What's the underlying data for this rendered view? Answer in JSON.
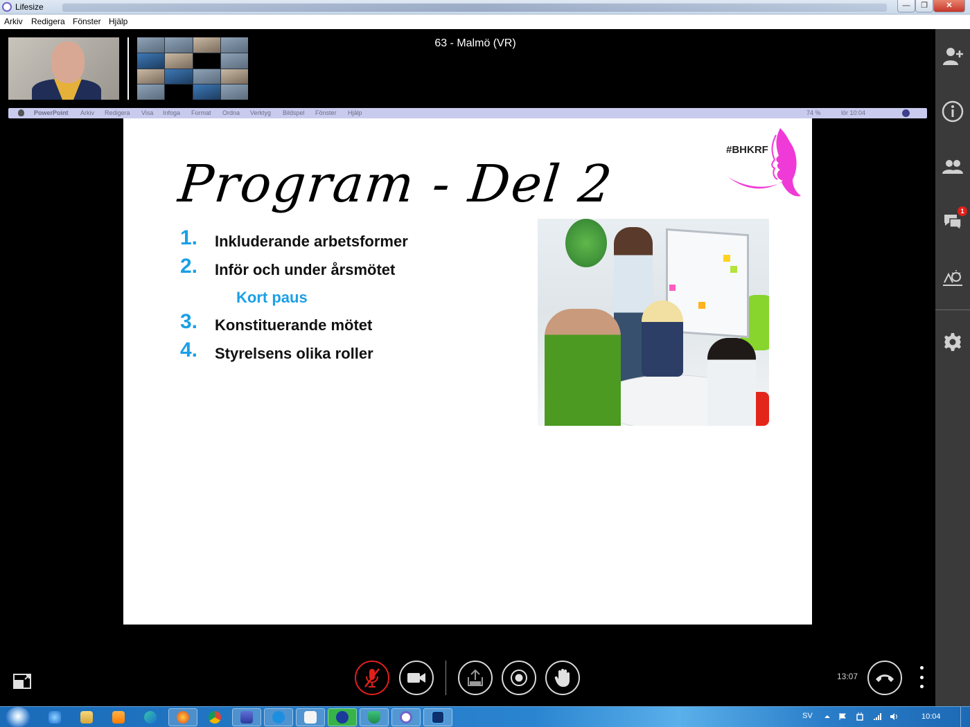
{
  "window": {
    "title": "Lifesize"
  },
  "menubar": {
    "items": [
      "Arkiv",
      "Redigera",
      "Fönster",
      "Hjälp"
    ]
  },
  "meeting": {
    "title": "63 - Malmö (VR)",
    "call_duration": "13:07"
  },
  "shared_screen": {
    "menubar_items": [
      "PowerPoint",
      "Arkiv",
      "Redigera",
      "Visa",
      "Infoga",
      "Format",
      "Ordna",
      "Verktyg",
      "Bildspel",
      "Fönster",
      "Hjälp"
    ],
    "battery": "74 %",
    "clock": "lör 10:04"
  },
  "slide": {
    "title": "Program - Del 2",
    "hashtag": "#BHKRF",
    "agenda": [
      {
        "num": "1.",
        "text": "Inkluderande arbetsformer"
      },
      {
        "num": "2.",
        "text": "Inför och under årsmötet"
      },
      {
        "num": "3.",
        "text": "Konstituerande mötet"
      },
      {
        "num": "4.",
        "text": "Styrelsens olika roller"
      }
    ],
    "break_label": "Kort paus",
    "colors": {
      "accent": "#1aa0e6",
      "logo": "#f03ad7"
    }
  },
  "sidebar": {
    "chat_unread": "1",
    "icons": [
      "add-participant-icon",
      "info-icon",
      "participants-icon",
      "chat-icon",
      "presentation-icon",
      "settings-icon"
    ]
  },
  "controls": {
    "icons": [
      "mic-muted-icon",
      "camera-icon",
      "share-icon",
      "record-icon",
      "raise-hand-icon",
      "hang-up-icon"
    ]
  },
  "taskbar": {
    "language": "SV",
    "clock": "10:04"
  }
}
